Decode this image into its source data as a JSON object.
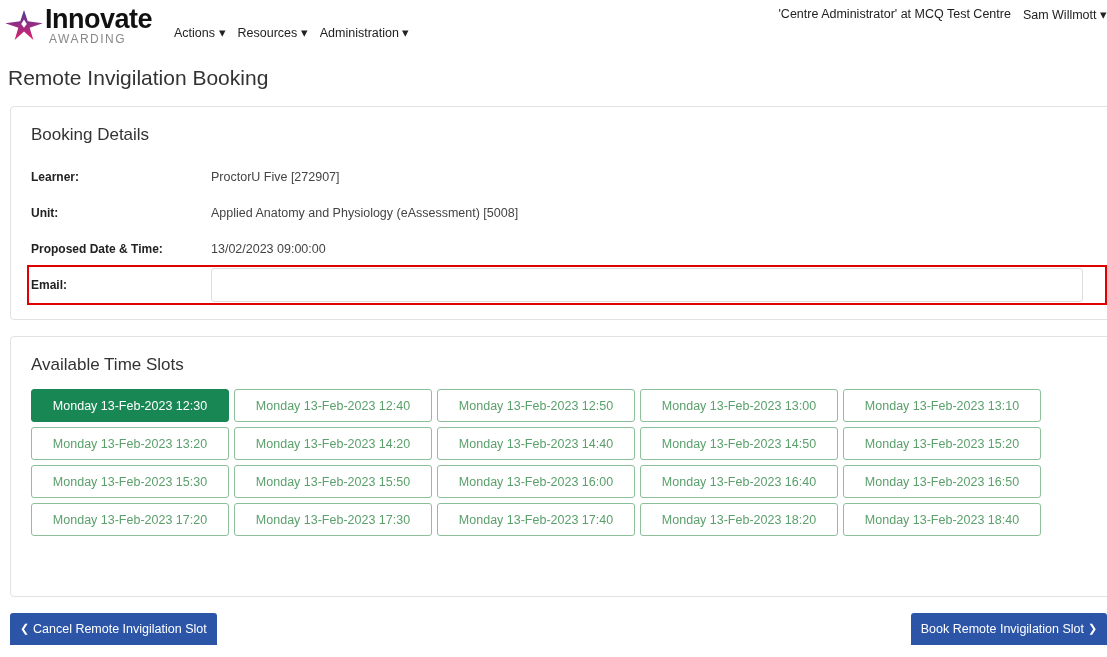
{
  "header": {
    "logo": {
      "name": "Innovate",
      "tagline": "AWARDING"
    },
    "nav": [
      {
        "label": "Actions",
        "caret": "▾"
      },
      {
        "label": "Resources",
        "caret": "▾"
      },
      {
        "label": "Administration",
        "caret": "▾"
      }
    ],
    "role": "'Centre Administrator' at MCQ Test Centre",
    "user": {
      "label": "Sam Willmott",
      "caret": "▾"
    }
  },
  "title": "Remote Invigilation Booking",
  "booking_details": {
    "heading": "Booking Details",
    "rows": [
      {
        "kind": "text",
        "label": "Learner:",
        "value": "ProctorU Five [272907]",
        "highlighted": false
      },
      {
        "kind": "text",
        "label": "Unit:",
        "value": "Applied Anatomy and Physiology (eAssessment)  [5008]",
        "highlighted": false
      },
      {
        "kind": "text",
        "label": "Proposed Date & Time:",
        "value": "13/02/2023 09:00:00",
        "highlighted": false
      },
      {
        "kind": "field",
        "label": "Email:",
        "highlighted": true
      }
    ]
  },
  "time_slots": {
    "heading": "Available Time Slots",
    "slots": [
      {
        "label": "Monday 13-Feb-2023 12:30",
        "selected": true
      },
      {
        "label": "Monday 13-Feb-2023 12:40",
        "selected": false
      },
      {
        "label": "Monday 13-Feb-2023 12:50",
        "selected": false
      },
      {
        "label": "Monday 13-Feb-2023 13:00",
        "selected": false
      },
      {
        "label": "Monday 13-Feb-2023 13:10",
        "selected": false
      },
      {
        "label": "Monday 13-Feb-2023 13:20",
        "selected": false
      },
      {
        "label": "Monday 13-Feb-2023 14:20",
        "selected": false
      },
      {
        "label": "Monday 13-Feb-2023 14:40",
        "selected": false
      },
      {
        "label": "Monday 13-Feb-2023 14:50",
        "selected": false
      },
      {
        "label": "Monday 13-Feb-2023 15:20",
        "selected": false
      },
      {
        "label": "Monday 13-Feb-2023 15:30",
        "selected": false
      },
      {
        "label": "Monday 13-Feb-2023 15:50",
        "selected": false
      },
      {
        "label": "Monday 13-Feb-2023 16:00",
        "selected": false
      },
      {
        "label": "Monday 13-Feb-2023 16:40",
        "selected": false
      },
      {
        "label": "Monday 13-Feb-2023 16:50",
        "selected": false
      },
      {
        "label": "Monday 13-Feb-2023 17:20",
        "selected": false
      },
      {
        "label": "Monday 13-Feb-2023 17:30",
        "selected": false
      },
      {
        "label": "Monday 13-Feb-2023 17:40",
        "selected": false
      },
      {
        "label": "Monday 13-Feb-2023 18:20",
        "selected": false
      },
      {
        "label": "Monday 13-Feb-2023 18:40",
        "selected": false
      }
    ]
  },
  "actions": [
    {
      "kind": "back",
      "label": "Cancel Remote Invigilation Slot",
      "icon": "❮"
    },
    {
      "kind": "next",
      "label": "Book Remote Invigilation Slot",
      "icon": "❯"
    }
  ]
}
